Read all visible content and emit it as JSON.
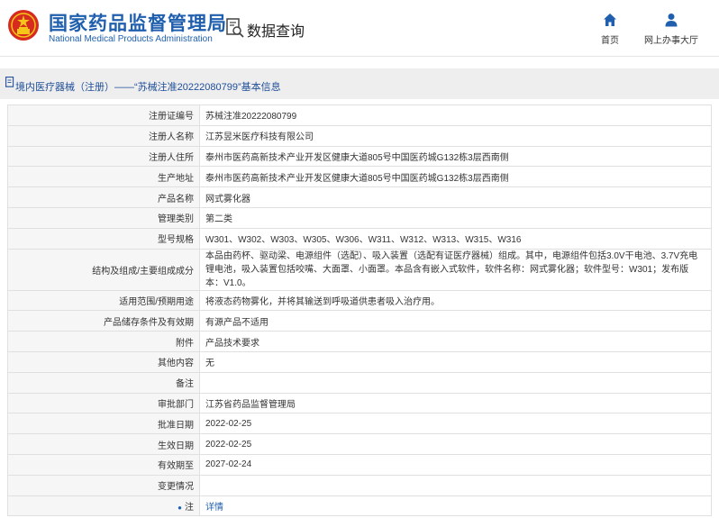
{
  "header": {
    "title_cn": "国家药品监督管理局",
    "title_en": "National Medical Products Administration",
    "query_label": "数据查询",
    "nav_home": "首页",
    "nav_office": "网上办事大厅"
  },
  "breadcrumb": "境内医疗器械（注册）——“苏械注准20222080799”基本信息",
  "rows": [
    {
      "label": "注册证编号",
      "value": "苏械注准20222080799"
    },
    {
      "label": "注册人名称",
      "value": "江苏昱米医疗科技有限公司"
    },
    {
      "label": "注册人住所",
      "value": "泰州市医药高新技术产业开发区健康大道805号中国医药城G132栋3层西南侧"
    },
    {
      "label": "生产地址",
      "value": "泰州市医药高新技术产业开发区健康大道805号中国医药城G132栋3层西南侧"
    },
    {
      "label": "产品名称",
      "value": "网式雾化器"
    },
    {
      "label": "管理类别",
      "value": "第二类"
    },
    {
      "label": "型号规格",
      "value": "W301、W302、W303、W305、W306、W311、W312、W313、W315、W316"
    },
    {
      "label": "结构及组成/主要组成成分",
      "value": "本品由药杯、驱动梁、电源组件（选配）、吸入装置（选配有证医疗器械）组成。其中，电源组件包括3.0V干电池、3.7V充电锂电池，吸入装置包括咬嘴、大面罩、小面罩。本品含有嵌入式软件，软件名称：网式雾化器；软件型号：W301；发布版本：V1.0。"
    },
    {
      "label": "适用范围/预期用途",
      "value": "将液态药物雾化，并将其输送到呼吸道供患者吸入治疗用。"
    },
    {
      "label": "产品储存条件及有效期",
      "value": "有源产品不适用"
    },
    {
      "label": "附件",
      "value": "产品技术要求"
    },
    {
      "label": "其他内容",
      "value": "无"
    },
    {
      "label": "备注",
      "value": ""
    },
    {
      "label": "审批部门",
      "value": "江苏省药品监督管理局"
    },
    {
      "label": "批准日期",
      "value": "2022-02-25"
    },
    {
      "label": "生效日期",
      "value": "2022-02-25"
    },
    {
      "label": "有效期至",
      "value": "2027-02-24"
    },
    {
      "label": "变更情况",
      "value": ""
    },
    {
      "label": "注",
      "value": "详情"
    }
  ]
}
